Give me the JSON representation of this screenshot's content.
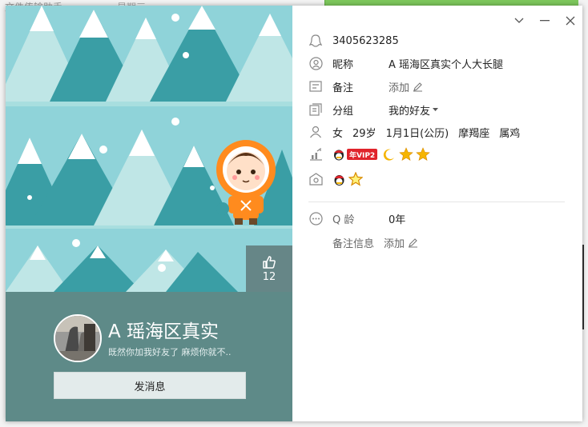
{
  "background": {
    "left_text": "文件传输助手",
    "left_text2": "星期三"
  },
  "window_controls": {
    "collapse": "chevron-down-icon",
    "minimize": "minimize-icon",
    "close": "close-icon"
  },
  "cover": {
    "like_count": "12"
  },
  "profile": {
    "display_name": "A  瑶海区真实",
    "signature": "既然你加我好友了 麻烦你就不..",
    "send_message_label": "发消息"
  },
  "info": {
    "qq_number": "3405623285",
    "nickname_label": "昵称",
    "nickname": "A  瑶海区真实个人大长腿",
    "remark_label": "备注",
    "remark_action": "添加",
    "group_label": "分组",
    "group_value": "我的好友",
    "gender": "女",
    "age": "29岁",
    "birthday": "1月1日(公历)",
    "zodiac": "摩羯座",
    "chinese_zodiac": "属鸡",
    "vip_badge": "年VIP2",
    "qage_label": "Q 龄",
    "qage_value": "0年",
    "remark_info_label": "备注信息",
    "remark_info_action": "添加"
  },
  "colors": {
    "cover_bg": "#8fd3d9",
    "tree_dark": "#3a9ea5",
    "tree_light": "#bfe6e6",
    "bottom_panel": "#5e8a88",
    "vip_red": "#e0232b",
    "star": "#f5b400"
  }
}
